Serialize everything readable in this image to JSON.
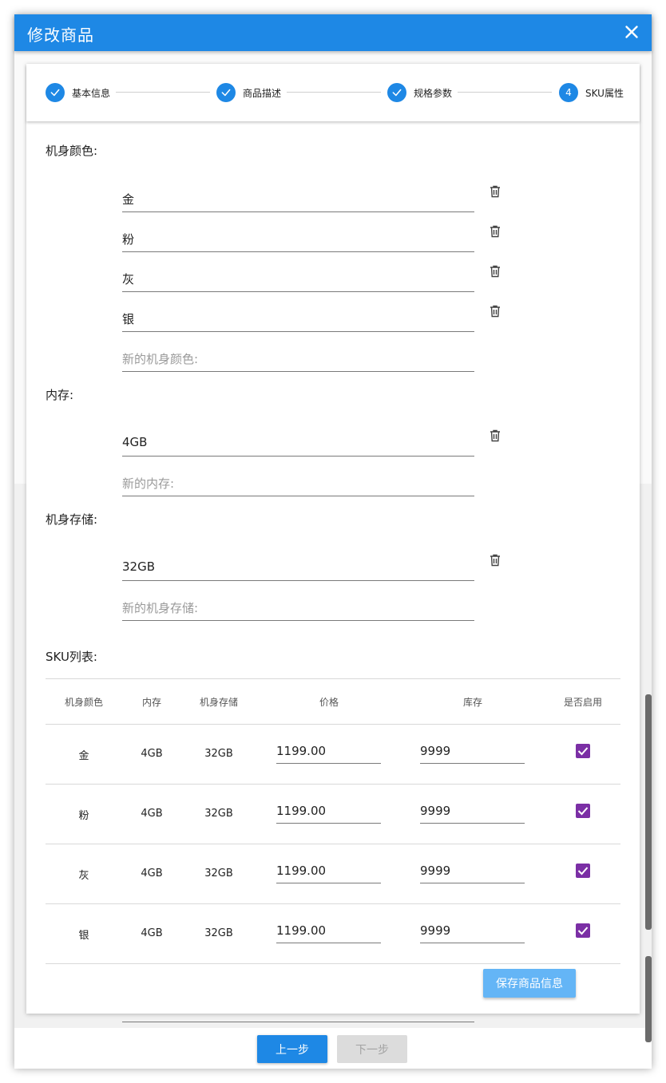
{
  "dialog": {
    "title": "修改商品"
  },
  "steps": [
    {
      "label": "基本信息",
      "done": true,
      "num": "1"
    },
    {
      "label": "商品描述",
      "done": true,
      "num": "2"
    },
    {
      "label": "规格参数",
      "done": true,
      "num": "3"
    },
    {
      "label": "SKU属性",
      "done": false,
      "num": "4"
    }
  ],
  "specs": {
    "color": {
      "label": "机身颜色:",
      "values": [
        "金",
        "粉",
        "灰",
        "银"
      ],
      "placeholder": "新的机身颜色:"
    },
    "memory": {
      "label": "内存:",
      "values": [
        "4GB"
      ],
      "placeholder": "新的内存:"
    },
    "storage": {
      "label": "机身存储:",
      "values": [
        "32GB"
      ],
      "placeholder": "新的机身存储:"
    }
  },
  "sku": {
    "title": "SKU列表:",
    "headers": [
      "机身颜色",
      "内存",
      "机身存储",
      "价格",
      "库存",
      "是否启用"
    ],
    "rows": [
      {
        "color": "金",
        "memory": "4GB",
        "storage": "32GB",
        "price": "1199.00",
        "stock": "9999",
        "enabled": true
      },
      {
        "color": "粉",
        "memory": "4GB",
        "storage": "32GB",
        "price": "1199.00",
        "stock": "9999",
        "enabled": true
      },
      {
        "color": "灰",
        "memory": "4GB",
        "storage": "32GB",
        "price": "1199.00",
        "stock": "9999",
        "enabled": true
      },
      {
        "color": "银",
        "memory": "4GB",
        "storage": "32GB",
        "price": "1199.00",
        "stock": "9999",
        "enabled": true
      }
    ],
    "save_label": "保存商品信息"
  },
  "footer": {
    "prev_label": "上一步",
    "next_label": "下一步"
  },
  "colors": {
    "primary": "#1e88e5",
    "checkbox": "#7b2fa5",
    "save": "#64b5f6"
  }
}
